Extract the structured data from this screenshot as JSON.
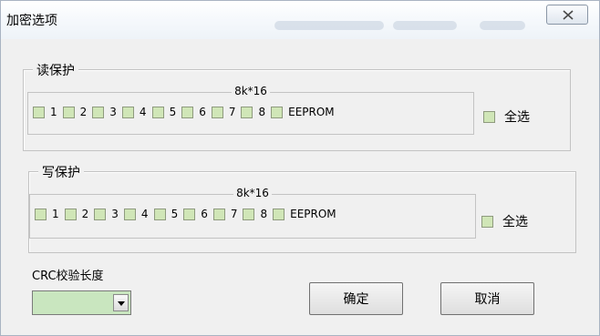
{
  "window": {
    "title": "加密选项"
  },
  "read_protect": {
    "label": "读保护",
    "inner_label": "8k*16",
    "items": [
      "1",
      "2",
      "3",
      "4",
      "5",
      "6",
      "7",
      "8",
      "EEPROM"
    ],
    "select_all": "全选"
  },
  "write_protect": {
    "label": "写保护",
    "inner_label": "8k*16",
    "items": [
      "1",
      "2",
      "3",
      "4",
      "5",
      "6",
      "7",
      "8",
      "EEPROM"
    ],
    "select_all": "全选"
  },
  "crc": {
    "label": "CRC校验长度",
    "value": ""
  },
  "buttons": {
    "ok": "确定",
    "cancel": "取消"
  },
  "colors": {
    "checkbox_fill": "#d0e6b7",
    "combo_fill": "#c9e6bf",
    "dialog_bg": "#f0f0f0"
  },
  "icons": {
    "close": "close-icon",
    "dropdown": "chevron-down-icon"
  }
}
